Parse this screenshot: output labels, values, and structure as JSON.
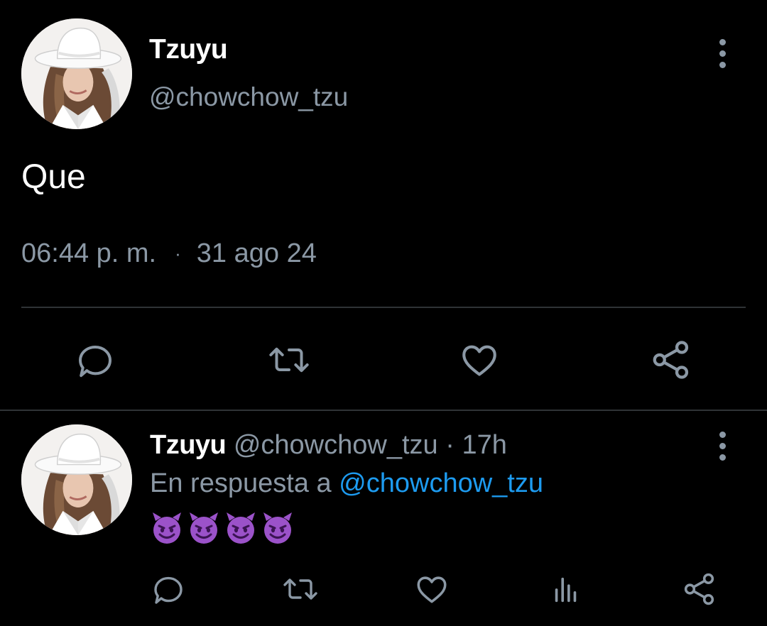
{
  "main_tweet": {
    "author_name": "Tzuyu",
    "author_handle": "@chowchow_tzu",
    "text": "Que",
    "time": "06:44 p. m.",
    "separator": "·",
    "date": "31 ago 24",
    "actions": [
      {
        "icon": "reply-icon"
      },
      {
        "icon": "retweet-icon"
      },
      {
        "icon": "like-icon"
      },
      {
        "icon": "share-icon"
      }
    ]
  },
  "reply": {
    "author_name": "Tzuyu",
    "author_handle": "@chowchow_tzu",
    "separator": "·",
    "age": "17h",
    "in_reply_prefix": "En respuesta a",
    "in_reply_handle": "@chowchow_tzu",
    "emoji_text": "😈😈😈😈",
    "emoji_icon": "smiling-devil-emoji",
    "actions": [
      {
        "icon": "reply-icon"
      },
      {
        "icon": "retweet-icon"
      },
      {
        "icon": "like-icon"
      },
      {
        "icon": "analytics-icon"
      },
      {
        "icon": "share-icon"
      }
    ]
  },
  "colors": {
    "background": "#000000",
    "primary_text": "#ffffff",
    "secondary_text": "#8b98a5",
    "accent_link": "#1d9bf0",
    "divider": "#2f3336"
  }
}
